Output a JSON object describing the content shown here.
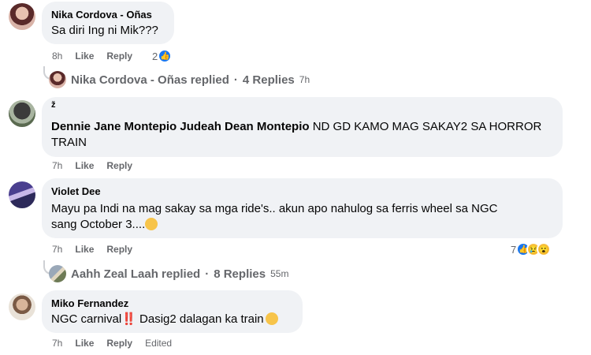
{
  "comments": [
    {
      "author": "Nika Cordova - Oñas",
      "text": "Sa diri Ing ni Mik???",
      "time": "8h",
      "like": "Like",
      "reply": "Reply",
      "reaction_count": "2"
    },
    {
      "pre": "ž",
      "author": "Dennie Jane Montepio Judeah Dean Montepio",
      "text": "ND GD KAMO MAG SAKAY2 SA HORROR TRAIN",
      "time": "7h",
      "like": "Like",
      "reply": "Reply"
    },
    {
      "author": "Violet Dee",
      "text_line1": "Mayu pa Indi na mag sakay sa mga ride's.. akun apo nahulog sa ferris wheel sa NGC",
      "text_line2": "sang October 3....",
      "time": "7h",
      "like": "Like",
      "reply": "Reply",
      "reaction_count": "7"
    },
    {
      "author": "Miko Fernandez",
      "text_a": "NGC carnival",
      "text_bang": "‼️",
      "text_b": " Dasig2 dalagan ka train",
      "time": "7h",
      "like": "Like",
      "reply": "Reply",
      "edited": "Edited"
    }
  ],
  "reply_threads": [
    {
      "name": "Nika Cordova - Oñas replied",
      "dot": "·",
      "count": "4 Replies",
      "time": "7h"
    },
    {
      "name": "Aahh Zeal Laah replied",
      "dot": "·",
      "count": "8 Replies",
      "time": "55m"
    }
  ],
  "icons": {
    "like": "like-icon",
    "sad": "sad-emoji-icon",
    "wow": "wow-emoji-icon"
  },
  "colors": {
    "like_blue": "#1877f2",
    "bubble": "#f0f2f5",
    "muted": "#65676b"
  }
}
